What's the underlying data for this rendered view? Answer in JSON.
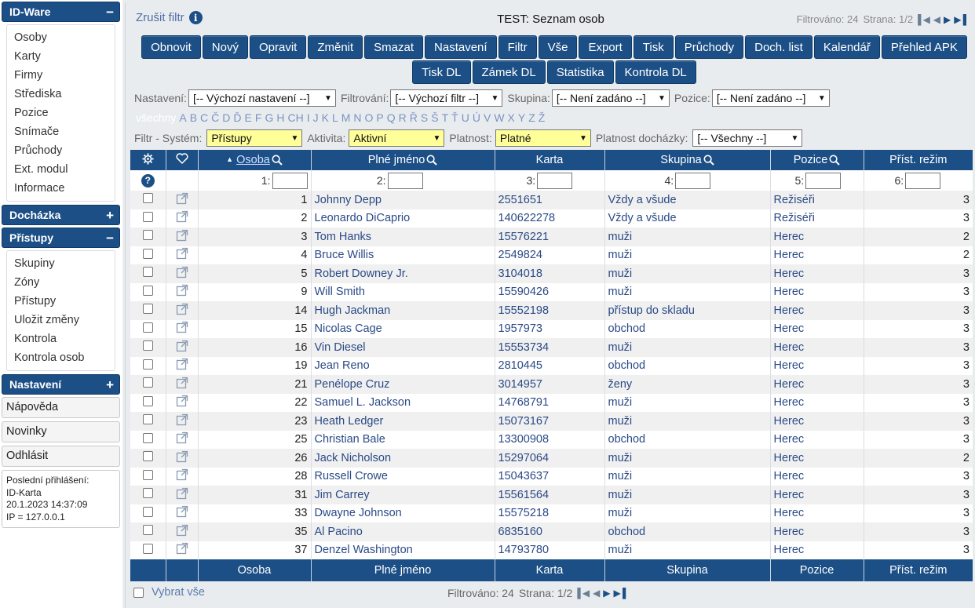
{
  "sidebar": {
    "sections": [
      {
        "title": "ID-Ware",
        "sign": "−",
        "items": [
          "Osoby",
          "Karty",
          "Firmy",
          "Střediska",
          "Pozice",
          "Snímače",
          "Průchody",
          "Ext. modul",
          "Informace"
        ]
      },
      {
        "title": "Docházka",
        "sign": "+"
      },
      {
        "title": "Přístupy",
        "sign": "−",
        "items": [
          "Skupiny",
          "Zóny",
          "Přístupy",
          "Uložit změny",
          "Kontrola",
          "Kontrola osob"
        ]
      },
      {
        "title": "Nastavení",
        "sign": "+"
      }
    ],
    "buttons": [
      "Nápověda",
      "Novinky",
      "Odhlásit"
    ],
    "last_login": {
      "label": "Poslední přihlášení:",
      "user": "ID-Karta",
      "date": "20.1.2023 14:37:09",
      "ip": "IP = 127.0.0.1"
    }
  },
  "top": {
    "clear_filter": "Zrušit filtr",
    "info_glyph": "i",
    "title": "TEST: Seznam osob",
    "filtered": "Filtrováno: 24",
    "page": "Strana: 1/2"
  },
  "toolbar": {
    "row1": [
      "Obnovit",
      "Nový",
      "Opravit",
      "Změnit",
      "Smazat",
      "Nastavení",
      "Filtr",
      "Vše",
      "Export",
      "Tisk",
      "Průchody",
      "Doch. list",
      "Kalendář",
      "Přehled APK"
    ],
    "row2": [
      "Tisk DL",
      "Zámek DL",
      "Statistika",
      "Kontrola DL"
    ]
  },
  "filters": {
    "nastaveni_label": "Nastavení:",
    "nastaveni_value": "[-- Výchozí nastavení --]",
    "filtrovani_label": "Filtrování:",
    "filtrovani_value": "[-- Výchozí filtr --]",
    "skupina_label": "Skupina:",
    "skupina_value": "[-- Není zadáno --]",
    "pozice_label": "Pozice:",
    "pozice_value": "[-- Není zadáno --]",
    "system_label": "Filtr - Systém:",
    "system_value": "Přístupy",
    "aktivita_label": "Aktivita:",
    "aktivita_value": "Aktivní",
    "platnost_label": "Platnost:",
    "platnost_value": "Platné",
    "platnost_doch_label": "Platnost docházky:",
    "platnost_doch_value": "[-- Všechny --]"
  },
  "alphabet": {
    "all": "všechny",
    "letters": [
      "A",
      "B",
      "C",
      "Č",
      "D",
      "Ď",
      "E",
      "F",
      "G",
      "H",
      "CH",
      "I",
      "J",
      "K",
      "L",
      "M",
      "N",
      "O",
      "P",
      "Q",
      "R",
      "Ř",
      "S",
      "Š",
      "T",
      "Ť",
      "U",
      "Ú",
      "V",
      "W",
      "X",
      "Y",
      "Z",
      "Ž"
    ]
  },
  "table": {
    "columns": [
      "Osoba",
      "Plné jméno",
      "Karta",
      "Skupina",
      "Pozice",
      "Příst. režim"
    ],
    "filter_labels": [
      "1:",
      "2:",
      "3:",
      "4:",
      "5:",
      "6:"
    ],
    "help_glyph": "?",
    "rows": [
      {
        "id": "1",
        "name": "Johnny Depp",
        "card": "2551651",
        "group": "Vždy a všude",
        "position": "Režiséři",
        "regime": "3"
      },
      {
        "id": "2",
        "name": "Leonardo DiCaprio",
        "card": "140622278",
        "group": "Vždy a všude",
        "position": "Režiséři",
        "regime": "3"
      },
      {
        "id": "3",
        "name": "Tom Hanks",
        "card": "15576221",
        "group": "muži",
        "position": "Herec",
        "regime": "2"
      },
      {
        "id": "4",
        "name": "Bruce Willis",
        "card": "2549824",
        "group": "muži",
        "position": "Herec",
        "regime": "2"
      },
      {
        "id": "5",
        "name": "Robert Downey Jr.",
        "card": "3104018",
        "group": "muži",
        "position": "Herec",
        "regime": "3"
      },
      {
        "id": "9",
        "name": "Will Smith",
        "card": "15590426",
        "group": "muži",
        "position": "Herec",
        "regime": "3"
      },
      {
        "id": "14",
        "name": "Hugh Jackman",
        "card": "15552198",
        "group": "přístup do skladu",
        "position": "Herec",
        "regime": "3"
      },
      {
        "id": "15",
        "name": "Nicolas Cage",
        "card": "1957973",
        "group": "obchod",
        "position": "Herec",
        "regime": "3"
      },
      {
        "id": "16",
        "name": "Vin Diesel",
        "card": "15553734",
        "group": "muži",
        "position": "Herec",
        "regime": "3"
      },
      {
        "id": "19",
        "name": "Jean Reno",
        "card": "2810445",
        "group": "obchod",
        "position": "Herec",
        "regime": "3"
      },
      {
        "id": "21",
        "name": "Penélope Cruz",
        "card": "3014957",
        "group": "ženy",
        "position": "Herec",
        "regime": "3"
      },
      {
        "id": "22",
        "name": "Samuel L. Jackson",
        "card": "14768791",
        "group": "muži",
        "position": "Herec",
        "regime": "3"
      },
      {
        "id": "23",
        "name": "Heath Ledger",
        "card": "15073167",
        "group": "muži",
        "position": "Herec",
        "regime": "3"
      },
      {
        "id": "25",
        "name": "Christian Bale",
        "card": "13300908",
        "group": "obchod",
        "position": "Herec",
        "regime": "3"
      },
      {
        "id": "26",
        "name": "Jack Nicholson",
        "card": "15297064",
        "group": "muži",
        "position": "Herec",
        "regime": "2"
      },
      {
        "id": "28",
        "name": "Russell Crowe",
        "card": "15043637",
        "group": "muži",
        "position": "Herec",
        "regime": "3"
      },
      {
        "id": "31",
        "name": "Jim Carrey",
        "card": "15561564",
        "group": "muži",
        "position": "Herec",
        "regime": "3"
      },
      {
        "id": "33",
        "name": "Dwayne Johnson",
        "card": "15575218",
        "group": "muži",
        "position": "Herec",
        "regime": "3"
      },
      {
        "id": "35",
        "name": "Al Pacino",
        "card": "6835160",
        "group": "obchod",
        "position": "Herec",
        "regime": "3"
      },
      {
        "id": "37",
        "name": "Denzel Washington",
        "card": "14793780",
        "group": "muži",
        "position": "Herec",
        "regime": "3"
      }
    ]
  },
  "bottom": {
    "select_all": "Vybrat vše",
    "filtered": "Filtrováno: 24",
    "page": "Strana: 1/2"
  },
  "colors": {
    "primary": "#1c4f86",
    "highlight": "#ffff99",
    "link": "#2a4a86"
  }
}
